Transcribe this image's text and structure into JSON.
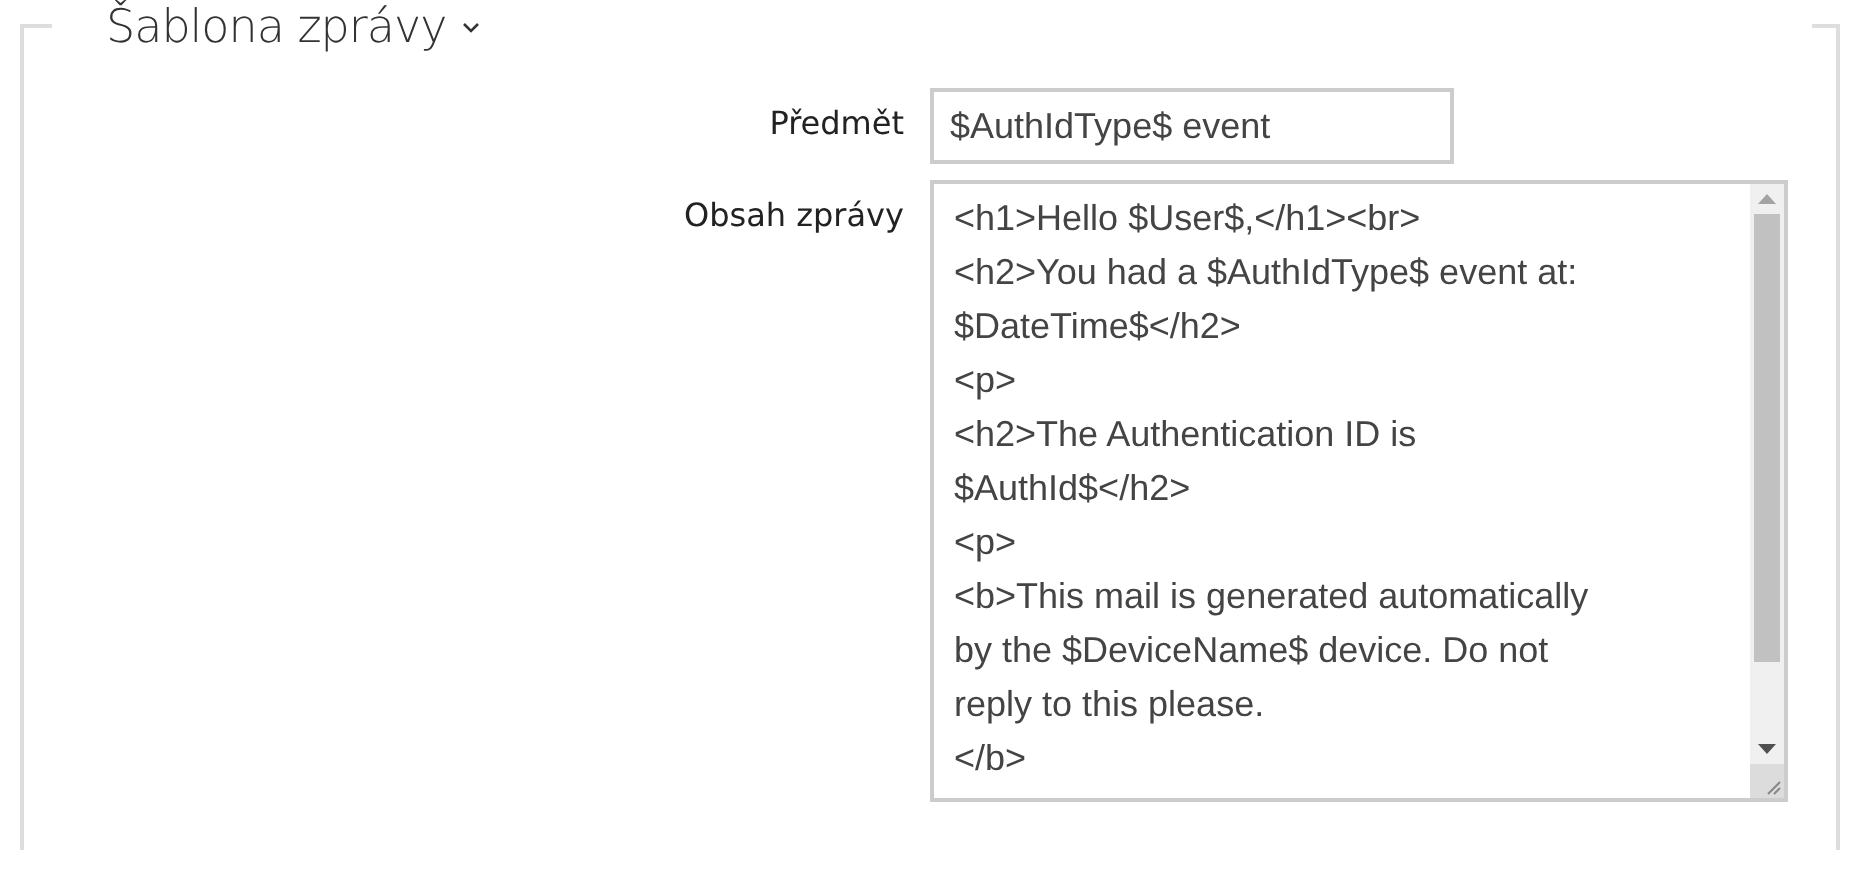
{
  "section": {
    "title": "Šablona zprávy",
    "expanded": true
  },
  "fields": [
    {
      "kind": "input",
      "label": "Předmět",
      "value": "$AuthIdType$ event"
    },
    {
      "kind": "textarea",
      "label": "Obsah zprávy",
      "lines": [
        "<h1>Hello $User$,</h1><br>",
        "<h2>You had a $AuthIdType$ event at:",
        "$DateTime$</h2>",
        "<p>",
        "<h2>The Authentication ID is",
        "$AuthId$</h2>",
        "<p>",
        "<b>This mail is generated automatically",
        "by the $DeviceName$ device. Do not",
        "reply to this please.",
        "</b>"
      ]
    }
  ]
}
